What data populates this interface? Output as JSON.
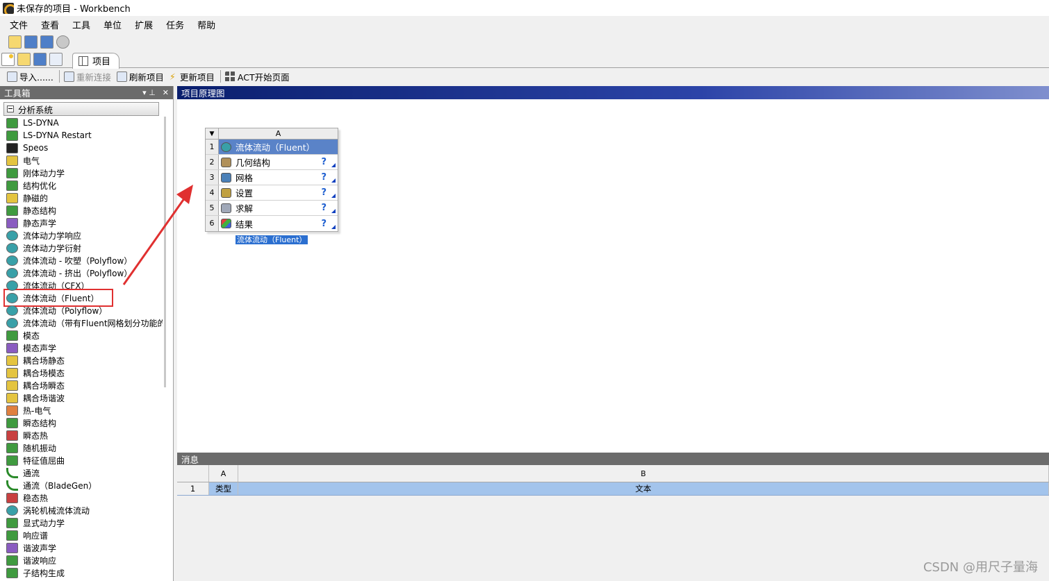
{
  "window": {
    "title": "未保存的项目 - Workbench"
  },
  "menu": [
    "文件",
    "查看",
    "工具",
    "单位",
    "扩展",
    "任务",
    "帮助"
  ],
  "project_tab": {
    "label": "项目"
  },
  "toolbar": {
    "import": "导入......",
    "reconnect": "重新连接",
    "refresh": "刷新项目",
    "update": "更新项目",
    "act_start": "ACT开始页面"
  },
  "toolbox": {
    "title": "工具箱",
    "pin_label": "▾ ⊥",
    "close_label": "✕",
    "group": "分析系统",
    "items": [
      {
        "label": "LS-DYNA",
        "icon": "green"
      },
      {
        "label": "LS-DYNA Restart",
        "icon": "green"
      },
      {
        "label": "Speos",
        "icon": "black"
      },
      {
        "label": "电气",
        "icon": "yellowg"
      },
      {
        "label": "刚体动力学",
        "icon": "green"
      },
      {
        "label": "结构优化",
        "icon": "green"
      },
      {
        "label": "静磁的",
        "icon": "yellowg"
      },
      {
        "label": "静态结构",
        "icon": "green"
      },
      {
        "label": "静态声学",
        "icon": "purple"
      },
      {
        "label": "流体动力学响应",
        "icon": "teal"
      },
      {
        "label": "流体动力学衍射",
        "icon": "teal"
      },
      {
        "label": "流体流动 - 吹塑（Polyflow）",
        "icon": "teal"
      },
      {
        "label": "流体流动 - 挤出（Polyflow）",
        "icon": "teal"
      },
      {
        "label": "流体流动（CFX）",
        "icon": "teal"
      },
      {
        "label": "流体流动（Fluent）",
        "icon": "teal",
        "highlighted": true
      },
      {
        "label": "流体流动（Polyflow）",
        "icon": "teal"
      },
      {
        "label": "流体流动（带有Fluent网格划分功能的）",
        "icon": "teal"
      },
      {
        "label": "模态",
        "icon": "green"
      },
      {
        "label": "模态声学",
        "icon": "purple"
      },
      {
        "label": "耦合场静态",
        "icon": "yellowg"
      },
      {
        "label": "耦合场模态",
        "icon": "yellowg"
      },
      {
        "label": "耦合场瞬态",
        "icon": "yellowg"
      },
      {
        "label": "耦合场谐波",
        "icon": "yellowg"
      },
      {
        "label": "热-电气",
        "icon": "orange"
      },
      {
        "label": "瞬态结构",
        "icon": "green"
      },
      {
        "label": "瞬态热",
        "icon": "red"
      },
      {
        "label": "随机振动",
        "icon": "green"
      },
      {
        "label": "特征值屈曲",
        "icon": "green"
      },
      {
        "label": "通流",
        "icon": "curve"
      },
      {
        "label": "通流（BladeGen）",
        "icon": "curve"
      },
      {
        "label": "稳态热",
        "icon": "red"
      },
      {
        "label": "涡轮机械流体流动",
        "icon": "teal"
      },
      {
        "label": "显式动力学",
        "icon": "green"
      },
      {
        "label": "响应谱",
        "icon": "green"
      },
      {
        "label": "谐波声学",
        "icon": "purple"
      },
      {
        "label": "谐波响应",
        "icon": "green"
      },
      {
        "label": "子结构生成",
        "icon": "green"
      }
    ]
  },
  "schematic": {
    "title": "项目原理图",
    "system": {
      "column": "A",
      "rows": [
        {
          "num": "1",
          "label": "流体流动（Fluent）",
          "icon": "teal",
          "status": ""
        },
        {
          "num": "2",
          "label": "几何结构",
          "icon": "brown",
          "status": "?"
        },
        {
          "num": "3",
          "label": "网格",
          "icon": "blue",
          "status": "?"
        },
        {
          "num": "4",
          "label": "设置",
          "icon": "gold",
          "status": "?"
        },
        {
          "num": "5",
          "label": "求解",
          "icon": "gray",
          "status": "?"
        },
        {
          "num": "6",
          "label": "结果",
          "icon": "multi",
          "status": "?"
        }
      ],
      "caption": "流体流动（Fluent）"
    }
  },
  "messages": {
    "title": "消息",
    "col_a": "A",
    "col_b": "B",
    "row": {
      "num": "1",
      "type": "类型",
      "text": "文本"
    }
  },
  "watermark": "CSDN @用尺子量海",
  "colors": {
    "highlight_box": "#e03030",
    "arrow": "#e03030",
    "selection": "#5a83c8"
  }
}
